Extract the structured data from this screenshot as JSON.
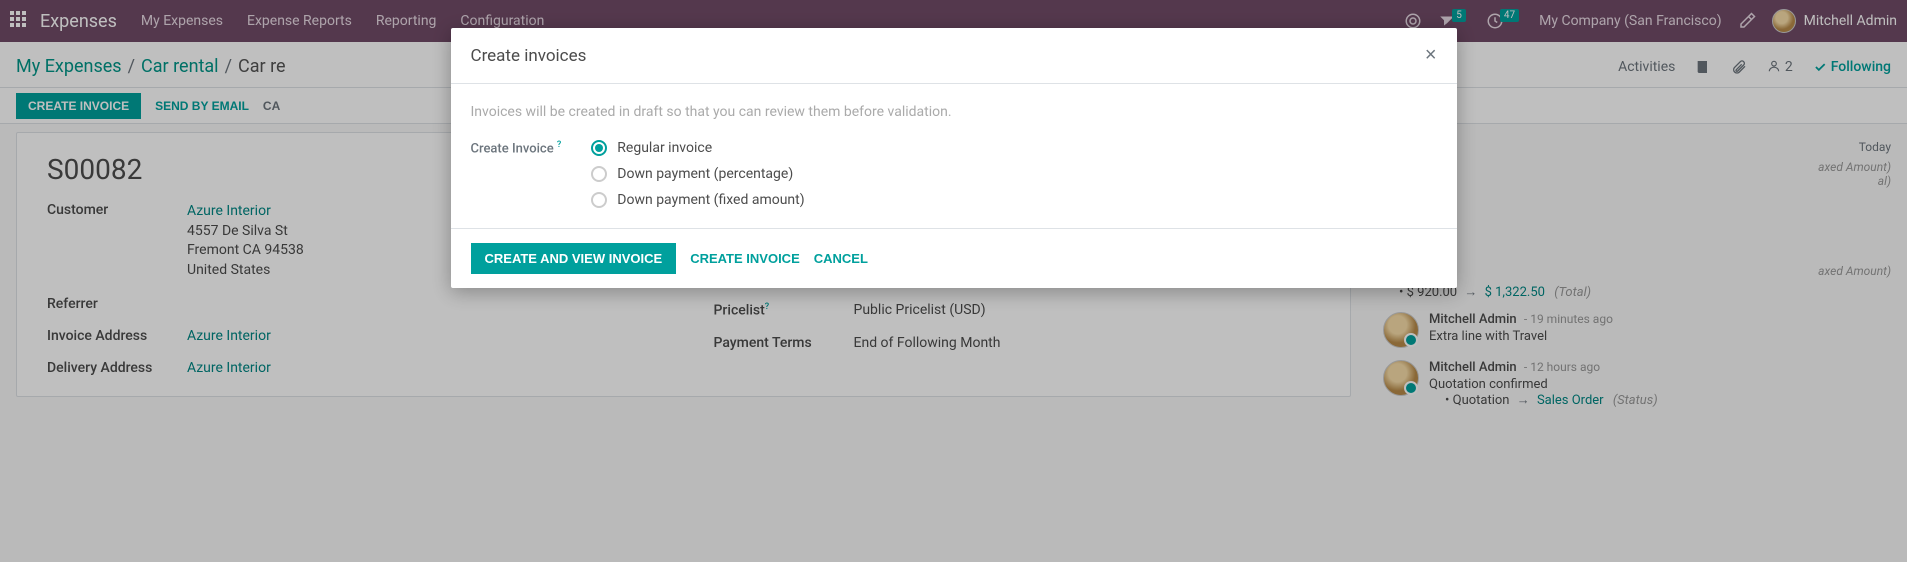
{
  "navbar": {
    "brand": "Expenses",
    "menu": [
      "My Expenses",
      "Expense Reports",
      "Reporting",
      "Configuration"
    ],
    "message_badge": "5",
    "activity_badge": "47",
    "company": "My Company (San Francisco)",
    "user": "Mitchell Admin"
  },
  "header": {
    "breadcrumbs": [
      "My Expenses",
      "Car rental",
      "Car re"
    ],
    "activities_label": "Activities",
    "follower_count": "2",
    "following_label": "Following"
  },
  "buttonbar": {
    "create_invoice": "CREATE INVOICE",
    "send_by_email": "SEND BY EMAIL",
    "cancel_short": "CA"
  },
  "form": {
    "record_name": "S00082",
    "customer_label": "Customer",
    "customer_value": "Azure Interior",
    "address_line1": "4557 De Silva St",
    "address_line2": "Fremont CA 94538",
    "address_line3": "United States",
    "referrer_label": "Referrer",
    "invoice_addr_label": "Invoice Address",
    "invoice_addr_value": "Azure Interior",
    "delivery_addr_label": "Delivery Address",
    "delivery_addr_value": "Azure Interior",
    "pricelist_label": "Pricelist",
    "pricelist_value": "Public Pricelist (USD)",
    "payment_terms_label": "Payment Terms",
    "payment_terms_value": "End of Following Month",
    "help_mark": "?"
  },
  "chatter": {
    "today_label": "Today",
    "taxed_amount_label": "axed Amount)",
    "total_label_partial": "al)",
    "line1_old": "$ 920.00",
    "line1_new": "$ 1,322.50",
    "line1_note": "(Total)",
    "author": "Mitchell Admin",
    "msg_a_time": "- 19 minutes ago",
    "msg_a_text": "Extra line with Travel",
    "msg_b_time": "- 12 hours ago",
    "msg_b_text": "Quotation confirmed",
    "msg_b_sub_from": "Quotation",
    "msg_b_sub_to": "Sales Order",
    "msg_b_sub_status": "(Status)",
    "taxed_amount_hint": "axed Amount)"
  },
  "modal": {
    "title": "Create invoices",
    "hint": "Invoices will be created in draft so that you can review them before validation.",
    "create_invoice_label": "Create Invoice",
    "help_mark": "?",
    "opt_regular": "Regular invoice",
    "opt_down_pct": "Down payment (percentage)",
    "opt_down_fixed": "Down payment (fixed amount)",
    "btn_create_view": "CREATE AND VIEW INVOICE",
    "btn_create": "CREATE INVOICE",
    "btn_cancel": "CANCEL"
  }
}
